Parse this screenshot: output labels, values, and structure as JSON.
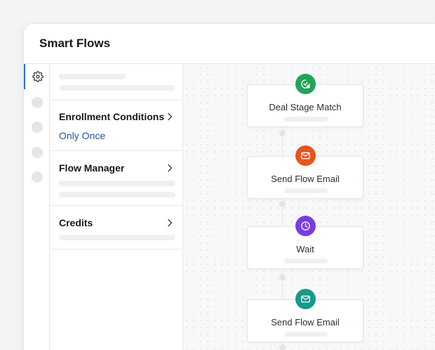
{
  "window": {
    "title": "Smart Flows"
  },
  "panel": {
    "sections": [
      {
        "title": "",
        "value": ""
      },
      {
        "title": "Enrollment Conditions",
        "value": "Only Once"
      },
      {
        "title": "Flow Manager",
        "value": ""
      },
      {
        "title": "Credits",
        "value": ""
      }
    ]
  },
  "rail": {
    "items": [
      {
        "icon": "gear-icon",
        "active": true
      },
      {
        "icon": "placeholder-dot"
      },
      {
        "icon": "placeholder-dot"
      },
      {
        "icon": "placeholder-dot"
      },
      {
        "icon": "placeholder-dot"
      }
    ]
  },
  "flow": {
    "steps": [
      {
        "label": "Deal Stage Match",
        "icon": "deal-stage-icon",
        "color": "#21a35a"
      },
      {
        "label": "Send Flow Email",
        "icon": "envelope-icon",
        "color": "#e8541c"
      },
      {
        "label": "Wait",
        "icon": "clock-icon",
        "color": "#7a3ee0"
      },
      {
        "label": "Send Flow Email",
        "icon": "envelope-icon",
        "color": "#159a88"
      }
    ]
  },
  "colors": {
    "accent": "#2c6fd6",
    "link_value": "#2452a8"
  }
}
